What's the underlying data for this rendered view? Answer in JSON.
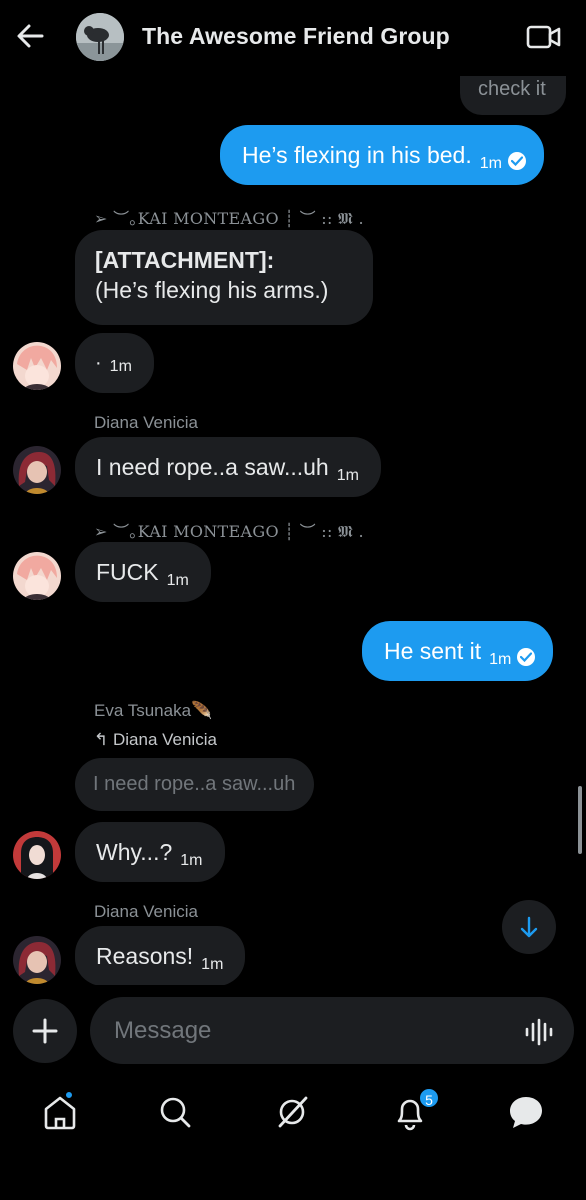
{
  "header": {
    "title": "The Awesome Friend Group"
  },
  "messages": [
    {
      "text": "check it"
    },
    {
      "text": "He’s flexing in his bed.",
      "time": "1m"
    },
    {
      "sender": "➢ ︶｡KAI MONTEAGO ┊ ︶ :: 𝕸 .",
      "line1": "[ATTACHMENT]:",
      "line2": "(He’s flexing his arms.)"
    },
    {
      "text": "·",
      "time": "1m"
    },
    {
      "sender": "Diana Venicia",
      "text": "I need rope..a saw...uh",
      "time": "1m"
    },
    {
      "sender": "➢ ︶｡KAI MONTEAGO ┊ ︶ :: 𝕸 .",
      "text": "FUCK",
      "time": "1m"
    },
    {
      "text": "He sent it",
      "time": "1m"
    },
    {
      "sender": "Eva Tsunaka🪶",
      "reply_to": "Diana Venicia",
      "quoted": "I need rope..a saw...uh",
      "text": "Why...?",
      "time": "1m"
    },
    {
      "sender": "Diana Venicia",
      "text": "Reasons!",
      "time": "1m"
    }
  ],
  "composer": {
    "placeholder": "Message"
  },
  "nav": {
    "notifications_badge": "5"
  },
  "colors": {
    "accent": "#1d9bf0",
    "bubble_in": "#1c1e21",
    "background": "#000000"
  }
}
